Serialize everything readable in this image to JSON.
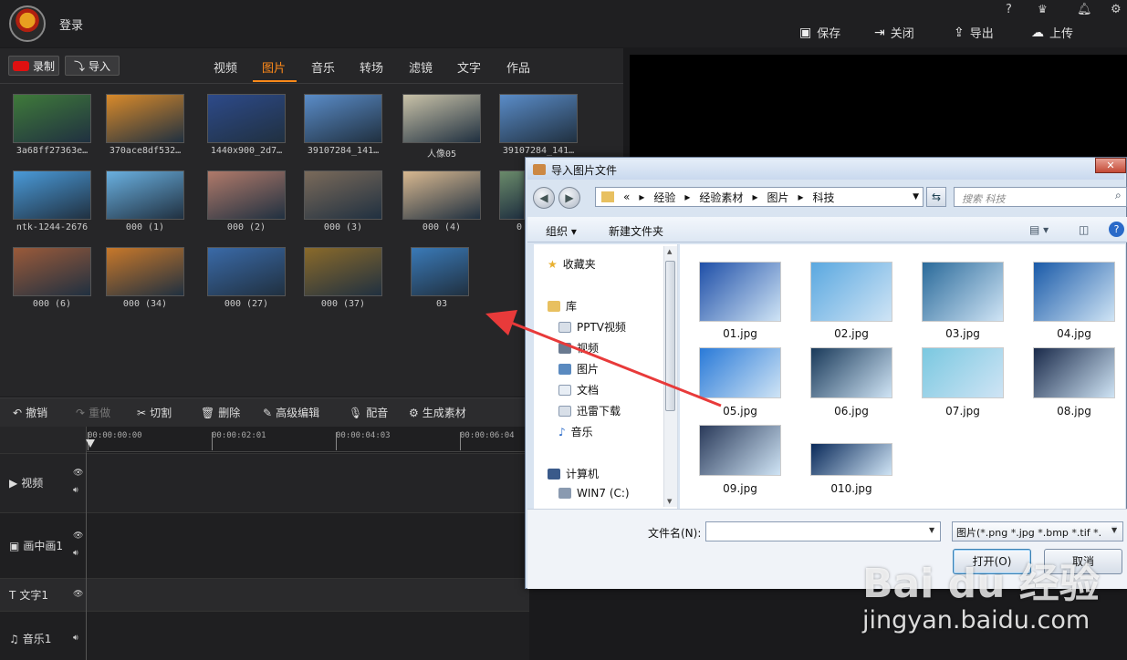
{
  "header": {
    "login": "登录",
    "help": "?",
    "actions": [
      {
        "icon": "save-icon",
        "label": "保存"
      },
      {
        "icon": "close-icon",
        "label": "关闭"
      },
      {
        "icon": "export-icon",
        "label": "导出"
      },
      {
        "icon": "upload-icon",
        "label": "上传"
      }
    ]
  },
  "media": {
    "record": "录制",
    "import": "导入",
    "tabs": [
      "视频",
      "图片",
      "音乐",
      "转场",
      "滤镜",
      "文字",
      "作品"
    ],
    "active_tab": "图片",
    "thumbs": [
      {
        "label": "3a68ff27363e…",
        "color": "#3f7a3a"
      },
      {
        "label": "370ace8df532…",
        "color": "#d98a2a"
      },
      {
        "label": "1440x900_2d7…",
        "color": "#2d4a8a"
      },
      {
        "label": "39107284_141…",
        "color": "#5a8cc8"
      },
      {
        "label": "人像05",
        "color": "#c9c2a8"
      },
      {
        "label": "39107284_141…",
        "color": "#5a8cc8"
      },
      {
        "label": "ntk-1244-2676",
        "color": "#4a9ad8"
      },
      {
        "label": "000 (1)",
        "color": "#6ab0e0"
      },
      {
        "label": "000 (2)",
        "color": "#b07a6a"
      },
      {
        "label": "000 (3)",
        "color": "#7a6a5a"
      },
      {
        "label": "000 (4)",
        "color": "#d8b890"
      },
      {
        "label": "0",
        "color": "#6a8a6a"
      },
      {
        "label": "000 (6)",
        "color": "#9a5a3a"
      },
      {
        "label": "000 (34)",
        "color": "#c8782a"
      },
      {
        "label": "000 (27)",
        "color": "#3a6aa8"
      },
      {
        "label": "000 (37)",
        "color": "#8a6a2a"
      },
      {
        "label": "03",
        "color": "#3a7ab8"
      }
    ]
  },
  "toolbar": [
    {
      "label": "撤销",
      "icon": "undo-icon"
    },
    {
      "label": "重做",
      "icon": "redo-icon"
    },
    {
      "label": "切割",
      "icon": "scissors-icon"
    },
    {
      "label": "删除",
      "icon": "trash-icon"
    },
    {
      "label": "高级编辑",
      "icon": "pen-icon"
    },
    {
      "label": "配音",
      "icon": "mic-icon"
    },
    {
      "label": "生成素材",
      "icon": "film-icon"
    }
  ],
  "ruler": [
    "00:00:00:00",
    "00:00:02:01",
    "00:00:04:03",
    "00:00:06:04"
  ],
  "tracks": [
    "视频",
    "画中画1",
    "文字1",
    "音乐1"
  ],
  "dialog": {
    "title": "导入图片文件",
    "path": [
      "«",
      "经验",
      "经验素材",
      "图片",
      "科技"
    ],
    "search": "搜索 科技",
    "organize": "组织 ▾",
    "new_folder": "新建文件夹",
    "nav": [
      {
        "label": "收藏夹",
        "icon": "star-icon"
      },
      {
        "label": "库",
        "icon": "library-icon"
      },
      {
        "label": "PPTV视频",
        "icon": "folder-icon"
      },
      {
        "label": "视频",
        "icon": "video-folder-icon"
      },
      {
        "label": "图片",
        "icon": "picture-folder-icon"
      },
      {
        "label": "文档",
        "icon": "document-folder-icon"
      },
      {
        "label": "迅雷下载",
        "icon": "download-folder-icon"
      },
      {
        "label": "音乐",
        "icon": "music-folder-icon"
      },
      {
        "label": "计算机",
        "icon": "computer-icon"
      },
      {
        "label": "WIN7 (C:)",
        "icon": "drive-icon"
      }
    ],
    "files": [
      {
        "name": "01.jpg",
        "color": "#1f4fa8"
      },
      {
        "name": "02.jpg",
        "color": "#5aa8e0"
      },
      {
        "name": "03.jpg",
        "color": "#2a6a9a"
      },
      {
        "name": "04.jpg",
        "color": "#1a5aa8"
      },
      {
        "name": "05.jpg",
        "color": "#2a7ad8"
      },
      {
        "name": "06.jpg",
        "color": "#1a3a5a"
      },
      {
        "name": "07.jpg",
        "color": "#7ac8e0"
      },
      {
        "name": "08.jpg",
        "color": "#1a2a4a"
      },
      {
        "name": "09.jpg",
        "color": "#2a3a5a"
      },
      {
        "name": "010.jpg",
        "color": "#0a2a5a"
      }
    ],
    "filename_label": "文件名(N):",
    "filename_value": "",
    "filetype": "图片(*.png *.jpg *.bmp *.tif *.",
    "open": "打开(O)",
    "cancel": "取消"
  },
  "watermark": {
    "brand": "Bai du 经验",
    "url": "jingyan.baidu.com"
  }
}
